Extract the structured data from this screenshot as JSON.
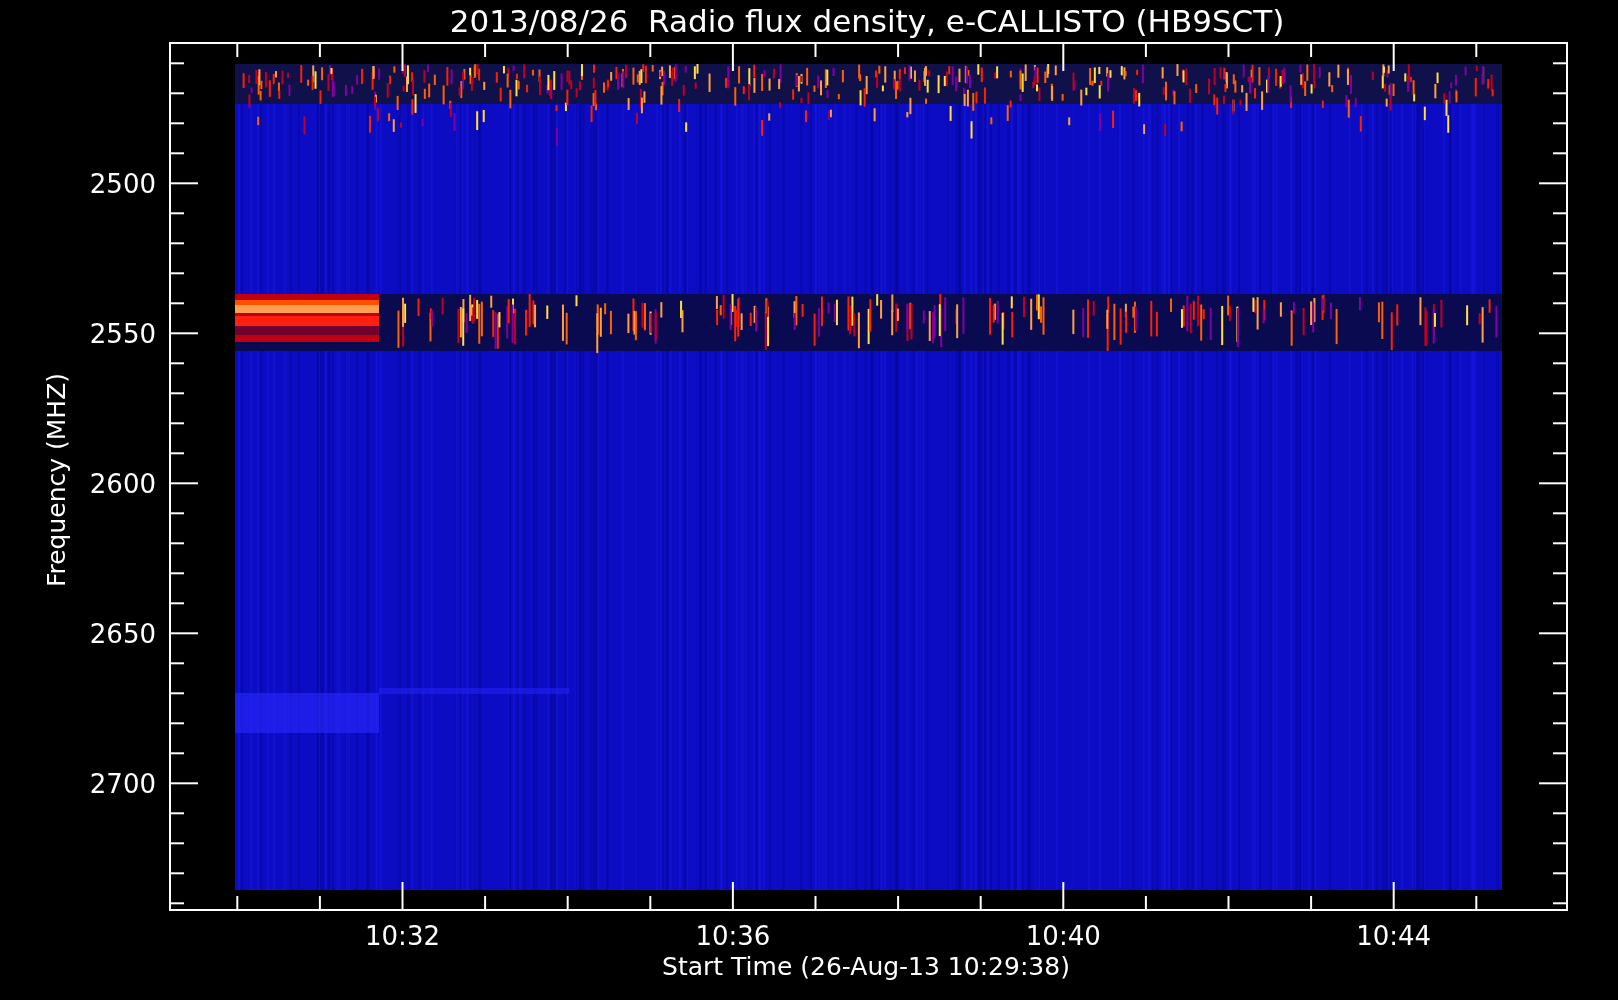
{
  "title": "2013/08/26  Radio flux density, e-CALLISTO (HB9SCT)",
  "y_axis": {
    "label": "Frequency (MHZ)",
    "ticks": [
      "2500",
      "2550",
      "2600",
      "2650",
      "2700"
    ]
  },
  "x_axis": {
    "label": "Start Time (26-Aug-13 10:29:38)",
    "ticks": [
      "10:32",
      "10:36",
      "10:40",
      "10:44"
    ]
  }
}
